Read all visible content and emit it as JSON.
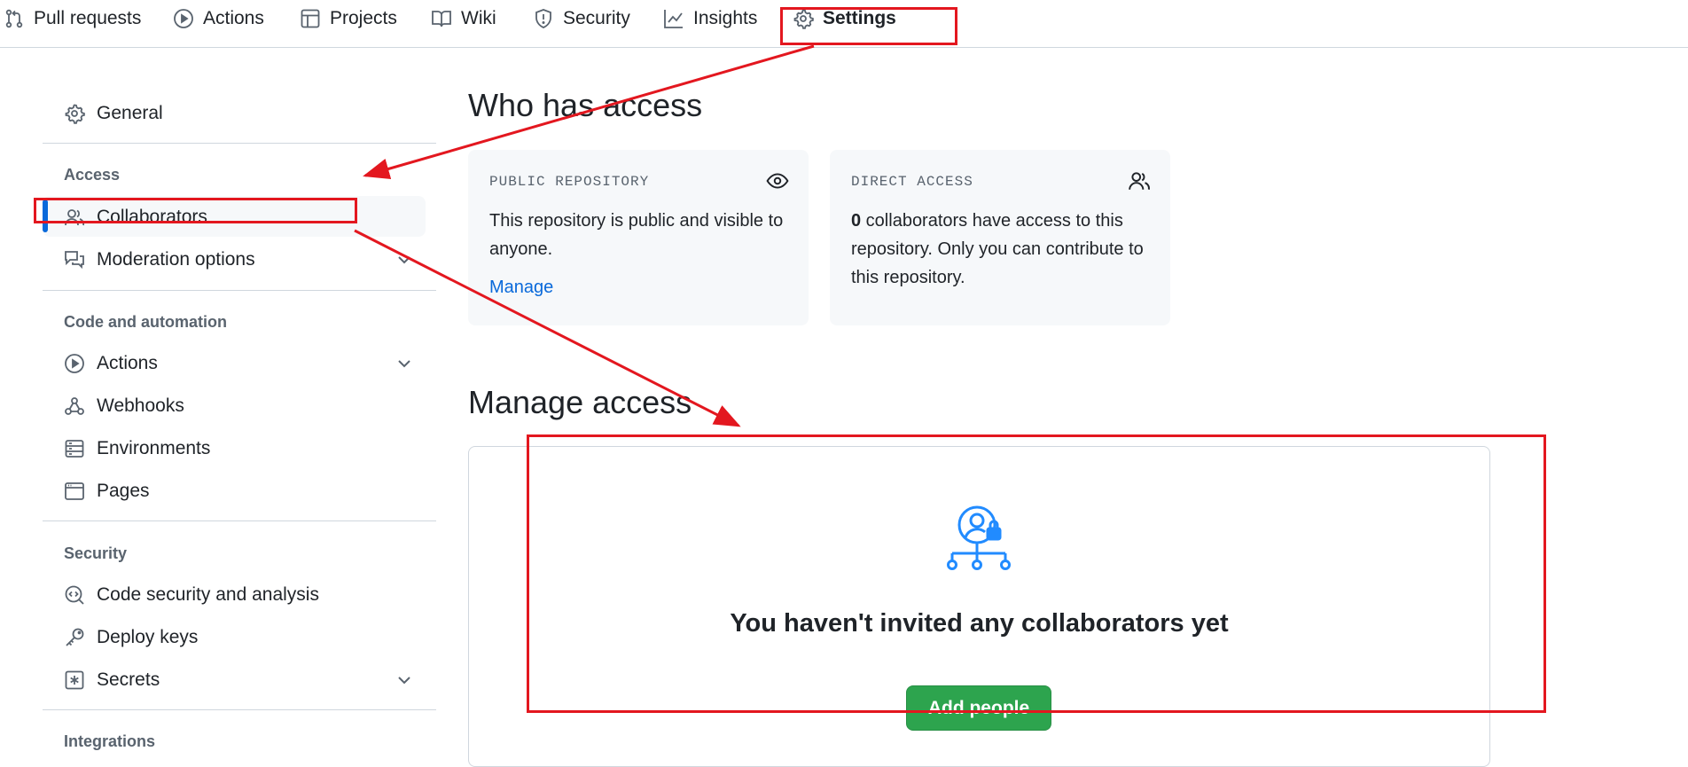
{
  "topnav": {
    "items": [
      {
        "label": "Pull requests",
        "icon": "pull-request-icon"
      },
      {
        "label": "Actions",
        "icon": "play-icon"
      },
      {
        "label": "Projects",
        "icon": "table-icon"
      },
      {
        "label": "Wiki",
        "icon": "book-icon"
      },
      {
        "label": "Security",
        "icon": "shield-icon"
      },
      {
        "label": "Insights",
        "icon": "graph-icon"
      },
      {
        "label": "Settings",
        "icon": "gear-icon",
        "active": true
      }
    ]
  },
  "sidebar": {
    "general": "General",
    "sections": [
      {
        "heading": "Access",
        "items": [
          {
            "label": "Collaborators",
            "icon": "people-icon",
            "selected": true
          },
          {
            "label": "Moderation options",
            "icon": "comment-discussion-icon",
            "expandable": true
          }
        ]
      },
      {
        "heading": "Code and automation",
        "items": [
          {
            "label": "Actions",
            "icon": "play-icon",
            "expandable": true
          },
          {
            "label": "Webhooks",
            "icon": "webhook-icon"
          },
          {
            "label": "Environments",
            "icon": "server-icon"
          },
          {
            "label": "Pages",
            "icon": "browser-icon"
          }
        ]
      },
      {
        "heading": "Security",
        "items": [
          {
            "label": "Code security and analysis",
            "icon": "codescan-icon"
          },
          {
            "label": "Deploy keys",
            "icon": "key-icon"
          },
          {
            "label": "Secrets",
            "icon": "asterisk-icon",
            "expandable": true
          }
        ]
      },
      {
        "heading": "Integrations",
        "items": []
      }
    ]
  },
  "main": {
    "who_title": "Who has access",
    "public_card": {
      "label": "PUBLIC REPOSITORY",
      "text": "This repository is public and visible to anyone.",
      "link": "Manage",
      "icon": "eye-icon"
    },
    "direct_card": {
      "label": "DIRECT ACCESS",
      "count": "0",
      "text": " collaborators have access to this repository. Only you can contribute to this repository.",
      "icon": "people-icon"
    },
    "manage_title": "Manage access",
    "empty_state": {
      "title": "You haven't invited any collaborators yet",
      "button": "Add people",
      "icon": "person-lock-org-icon"
    }
  },
  "colors": {
    "accent_blue": "#0969da",
    "annotation_red": "#e3171f",
    "button_green": "#2da44e",
    "nav_underline": "#fd8c73"
  }
}
